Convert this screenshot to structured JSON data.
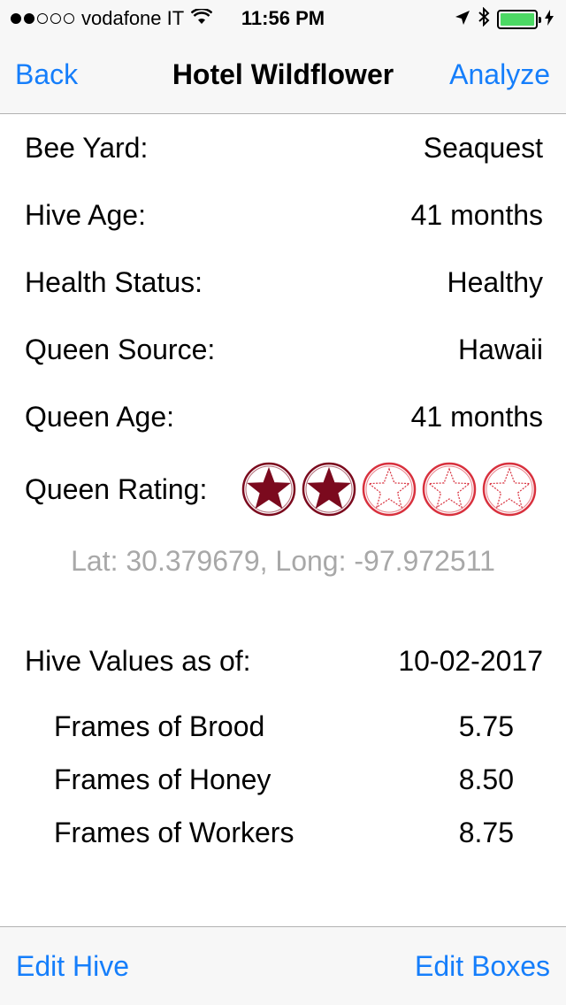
{
  "status_bar": {
    "signal_dots": [
      true,
      true,
      false,
      false,
      false
    ],
    "carrier": "vodafone IT",
    "time": "11:56 PM",
    "icons": [
      "wifi-icon",
      "location-arrow-icon",
      "bluetooth-icon",
      "battery-icon"
    ],
    "battery_level": 1.0,
    "battery_color": "#4cd964"
  },
  "nav": {
    "back_label": "Back",
    "title": "Hotel Wildflower",
    "right_label": "Analyze",
    "accent": "#157efb"
  },
  "details": [
    {
      "label": "Bee Yard:",
      "value": "Seaquest"
    },
    {
      "label": "Hive Age:",
      "value": "41 months"
    },
    {
      "label": "Health Status:",
      "value": "Healthy"
    },
    {
      "label": "Queen Source:",
      "value": "Hawaii"
    },
    {
      "label": "Queen Age:",
      "value": "41 months"
    }
  ],
  "queen_rating": {
    "label": "Queen Rating:",
    "rating": 2,
    "max": 5,
    "filled_color": "#7b0a1e",
    "empty_color": "#d8313e"
  },
  "coordinates": "Lat: 30.379679, Long: -97.972511",
  "hive_values": {
    "label": "Hive Values as of:",
    "date": "10-02-2017",
    "items": [
      {
        "label": "Frames of Brood",
        "value": "5.75"
      },
      {
        "label": "Frames of Honey",
        "value": "8.50"
      },
      {
        "label": "Frames of Workers",
        "value": "8.75"
      }
    ]
  },
  "toolbar": {
    "left_label": "Edit Hive",
    "right_label": "Edit Boxes"
  }
}
